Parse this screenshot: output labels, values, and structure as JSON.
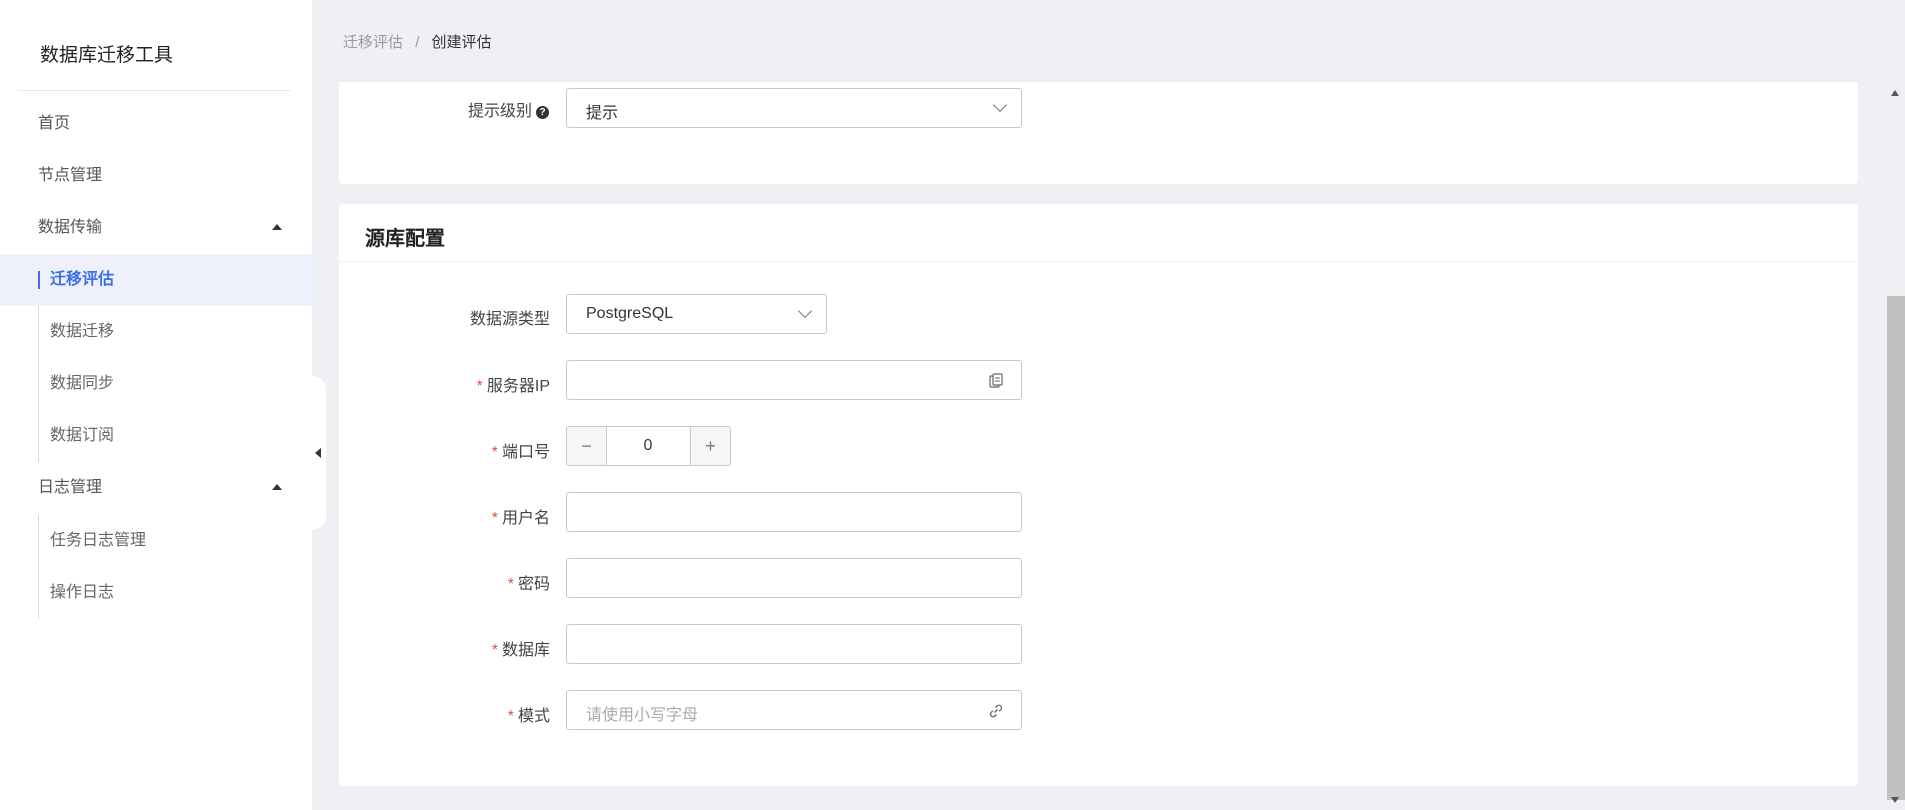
{
  "app": {
    "title": "数据库迁移工具"
  },
  "sidebar": {
    "items": [
      {
        "label": "首页"
      },
      {
        "label": "节点管理"
      },
      {
        "label": "数据传输"
      },
      {
        "label": "日志管理"
      }
    ],
    "data_transfer_sub": [
      {
        "label": "迁移评估",
        "active": true
      },
      {
        "label": "数据迁移"
      },
      {
        "label": "数据同步"
      },
      {
        "label": "数据订阅"
      }
    ],
    "log_sub": [
      {
        "label": "任务日志管理"
      },
      {
        "label": "操作日志"
      }
    ]
  },
  "breadcrumb": {
    "parent": "迁移评估",
    "separator": "/",
    "current": "创建评估"
  },
  "hint_section": {
    "label": "提示级别",
    "help_icon": "question-circle-icon",
    "value": "提示"
  },
  "source_config": {
    "title": "源库配置",
    "datasource_type": {
      "label": "数据源类型",
      "value": "PostgreSQL"
    },
    "server_ip": {
      "label": "服务器IP",
      "required": "*",
      "value": "",
      "icon": "copy-icon"
    },
    "port": {
      "label": "端口号",
      "required": "*",
      "value": "0",
      "minus": "−",
      "plus": "+"
    },
    "username": {
      "label": "用户名",
      "required": "*",
      "value": ""
    },
    "password": {
      "label": "密码",
      "required": "*",
      "value": ""
    },
    "database": {
      "label": "数据库",
      "required": "*",
      "value": ""
    },
    "schema": {
      "label": "模式",
      "required": "*",
      "placeholder": "请使用小写字母",
      "icon": "link-icon"
    }
  },
  "colors": {
    "accent": "#3b6ee8",
    "required": "#e84c3d",
    "active_bg": "#eef1fb",
    "page_bg": "#eef0f4"
  }
}
